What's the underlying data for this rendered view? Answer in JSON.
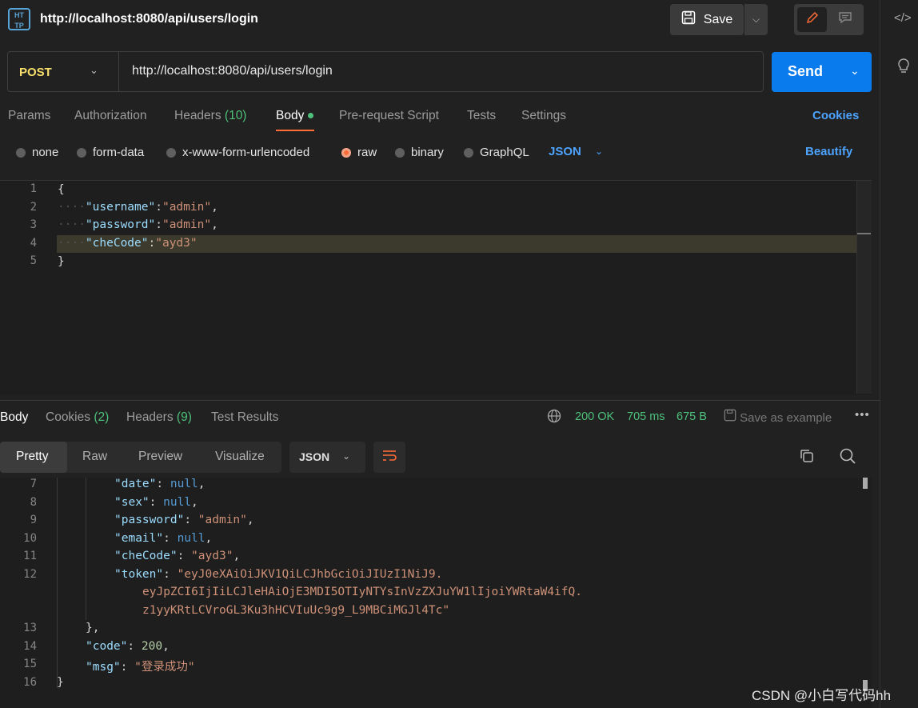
{
  "tab": {
    "title": "http://localhost:8080/api/users/login",
    "icon": "http-icon"
  },
  "toolbar": {
    "save_label": "Save"
  },
  "request": {
    "method": "POST",
    "url": "http://localhost:8080/api/users/login",
    "send_label": "Send"
  },
  "request_tabs": {
    "params": "Params",
    "authorization": "Authorization",
    "headers": "Headers",
    "headers_count": "(10)",
    "body": "Body",
    "prerequest": "Pre-request Script",
    "tests": "Tests",
    "settings": "Settings",
    "cookies": "Cookies"
  },
  "body_types": {
    "none": "none",
    "form_data": "form-data",
    "urlencoded": "x-www-form-urlencoded",
    "raw": "raw",
    "binary": "binary",
    "graphql": "GraphQL",
    "format": "JSON",
    "selected": "raw",
    "beautify": "Beautify"
  },
  "request_body": {
    "line_numbers": [
      "1",
      "2",
      "3",
      "4",
      "5"
    ],
    "open": "{",
    "close": "}",
    "username_key": "\"username\"",
    "username_val": "\"admin\"",
    "password_key": "\"password\"",
    "password_val": "\"admin\"",
    "checode_key": "\"cheCode\"",
    "checode_val": "\"ayd3\""
  },
  "response_tabs": {
    "body": "Body",
    "cookies": "Cookies",
    "cookies_count": "(2)",
    "headers": "Headers",
    "headers_count": "(9)",
    "test_results": "Test Results"
  },
  "response_status": {
    "status": "200 OK",
    "time": "705 ms",
    "size": "675 B",
    "save_example": "Save as example"
  },
  "response_views": {
    "pretty": "Pretty",
    "raw": "Raw",
    "preview": "Preview",
    "visualize": "Visualize",
    "format": "JSON"
  },
  "response_body": {
    "line_numbers": [
      "7",
      "8",
      "9",
      "10",
      "11",
      "12",
      "",
      "",
      "13",
      "14",
      "15",
      "16"
    ],
    "date_key": "\"date\"",
    "sex_key": "\"sex\"",
    "password_key": "\"password\"",
    "password_val": "\"admin\"",
    "email_key": "\"email\"",
    "checode_key": "\"cheCode\"",
    "checode_val": "\"ayd3\"",
    "token_key": "\"token\"",
    "token_line1": "\"eyJ0eXAiOiJKV1QiLCJhbGciOiJIUzI1NiJ9.",
    "token_line2": "eyJpZCI6IjIiLCJleHAiOjE3MDI5OTIyNTYsInVzZXJuYW1lIjoiYWRtaW4ifQ.",
    "token_line3": "z1yyKRtLCVroGL3Ku3hHCVIuUc9g9_L9MBCiMGJl4Tc\"",
    "null": "null",
    "code_key": "\"code\"",
    "code_val": "200",
    "msg_key": "\"msg\"",
    "msg_val": "\"登录成功\"",
    "close_obj": "}",
    "close_root": "}"
  },
  "watermark": "CSDN @小白写代码hh",
  "colors": {
    "accent": "#ff6c37",
    "link": "#4da3ff",
    "send": "#097bed",
    "success": "#4ec17a"
  }
}
